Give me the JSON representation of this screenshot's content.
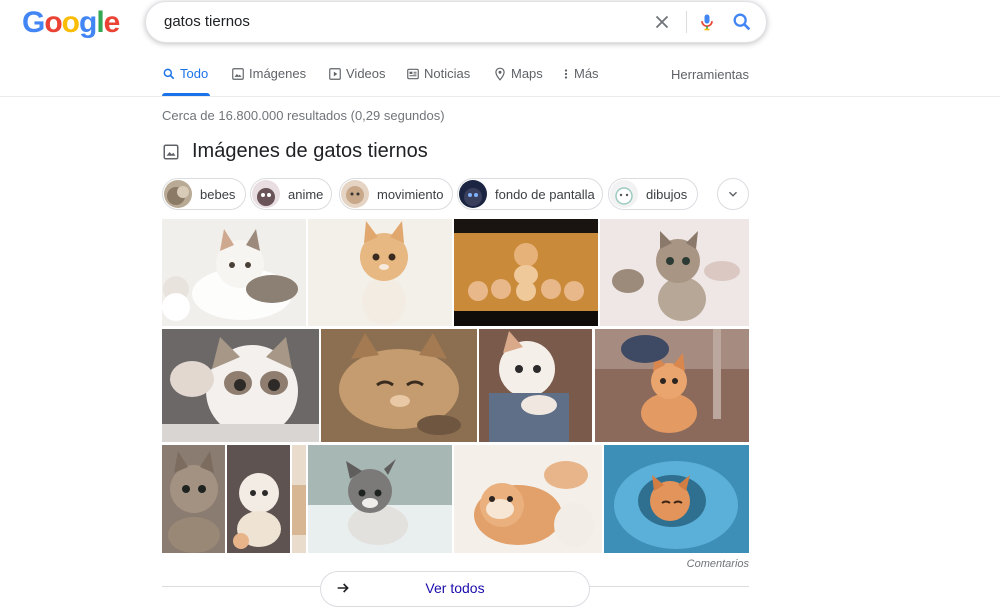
{
  "logo": {
    "letters": [
      "G",
      "o",
      "o",
      "g",
      "l",
      "e"
    ],
    "colors": [
      "#4285F4",
      "#EA4335",
      "#FBBC05",
      "#4285F4",
      "#34A853",
      "#EA4335"
    ]
  },
  "search": {
    "query": "gatos tiernos"
  },
  "tabs": [
    {
      "label": "Todo",
      "icon": "search-icon",
      "active": true
    },
    {
      "label": "Imágenes",
      "icon": "image-icon"
    },
    {
      "label": "Videos",
      "icon": "video-icon"
    },
    {
      "label": "Noticias",
      "icon": "news-icon"
    },
    {
      "label": "Maps",
      "icon": "map-pin-icon"
    },
    {
      "label": "Más",
      "icon": "more-vert-icon"
    }
  ],
  "tools_label": "Herramientas",
  "stats": "Cerca de 16.800.000 resultados (0,29 segundos)",
  "images_section": {
    "title": "Imágenes de gatos tiernos",
    "chips": [
      "bebes",
      "anime",
      "movimiento",
      "fondo de pantalla",
      "dibujos"
    ],
    "feedback": "Comentarios",
    "view_all": "Ver todos"
  },
  "colors": {
    "accent": "#1a73e8",
    "link": "#1a0dab",
    "muted": "#70757a"
  }
}
